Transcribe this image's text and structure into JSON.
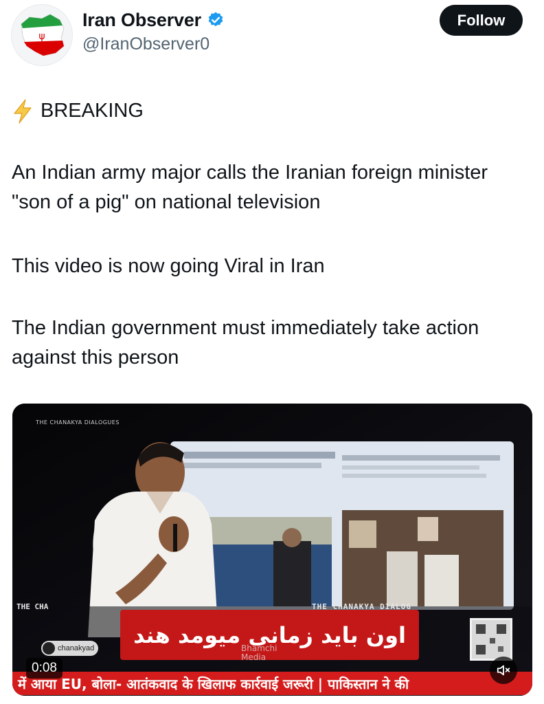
{
  "author": {
    "display_name": "Iran Observer",
    "handle": "@IranObserver0",
    "verified_icon": "verified-badge-icon",
    "accent_color": "#1d9bf0"
  },
  "follow_button": {
    "label": "Follow"
  },
  "tweet": {
    "breaking_icon": "lightning-bolt-icon",
    "breaking_label": "BREAKING",
    "paragraph_1": "An Indian army major calls the Iranian foreign minister \"son of a pig\" on national television",
    "paragraph_2": "This video is now going Viral in Iran",
    "paragraph_3": "The Indian government must immediately take action against this person"
  },
  "video": {
    "timestamp": "0:08",
    "mute_icon": "speaker-muted-icon",
    "subtitle": "اون باید زمانی میومد هند",
    "ticker_text": "में आया EU, बोला- आतंकवाद के खिलाफ कार्रवाई जरूरी | पाकिस्तान ने की",
    "show_brand_left": "THE CHA",
    "show_brand_right": "THE CHANAKYA DIALOG",
    "watermark_top": "THE CHANAKYA DIALOGUES",
    "channel_badge": "chanakyad",
    "media_watermark_1": "Bhamchi",
    "media_watermark_2": "Media",
    "ticker_color": "#d41c1c",
    "subtitle_bg_color": "#c41818"
  }
}
